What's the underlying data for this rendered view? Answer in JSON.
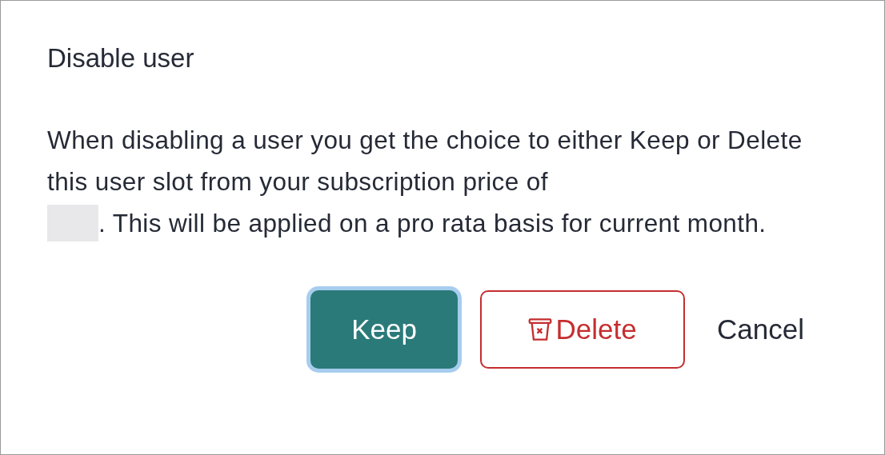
{
  "dialog": {
    "title": "Disable user",
    "message": {
      "before": "When disabling a user you get the choice to either Keep or Delete this user slot from your subscription price of",
      "redacted": true,
      "after": ". This will be applied on a pro rata basis for current month."
    },
    "buttons": [
      {
        "label": "Keep",
        "kind": "primary",
        "focused": true
      },
      {
        "label": "Delete",
        "kind": "danger",
        "focused": false
      },
      {
        "label": "Cancel",
        "kind": "plain",
        "focused": false
      }
    ]
  }
}
